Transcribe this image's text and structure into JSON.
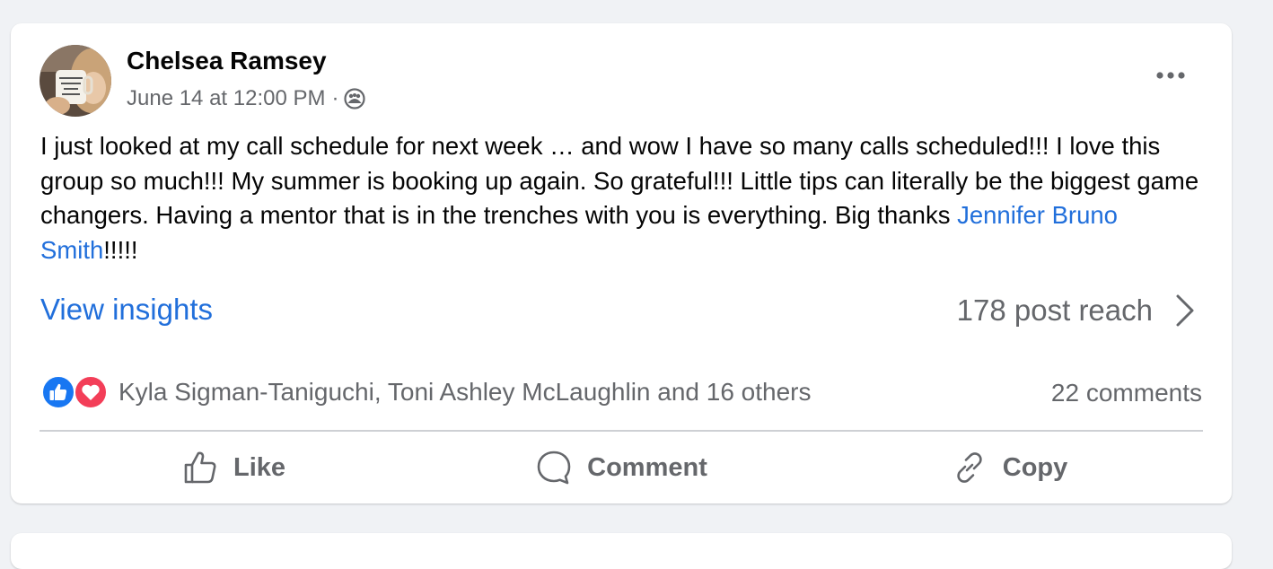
{
  "post": {
    "author": "Chelsea Ramsey",
    "timestamp": "June 14 at 12:00 PM",
    "separator": "·",
    "audience_icon": "group-icon",
    "body_text": "I just looked at my call schedule for next week … and wow I have so many calls scheduled!!! I love this group so much!!! My summer is booking up again. So grateful!!! Little tips can literally be the biggest game changers. Having a mentor that is in the trenches with you is everything. Big thanks ",
    "mention": "Jennifer Bruno Smith",
    "body_suffix": "!!!!!",
    "insights_label": "View insights",
    "reach_label": "178 post reach",
    "reactions_text": "Kyla Sigman-Taniguchi, Toni Ashley McLaughlin and 16 others",
    "comments_count": "22 comments"
  },
  "actions": {
    "like": "Like",
    "comment": "Comment",
    "copy": "Copy"
  },
  "colors": {
    "link": "#216fdb",
    "secondary_text": "#65676b",
    "like_blue": "#1877f2",
    "love_red": "#f33e58"
  }
}
